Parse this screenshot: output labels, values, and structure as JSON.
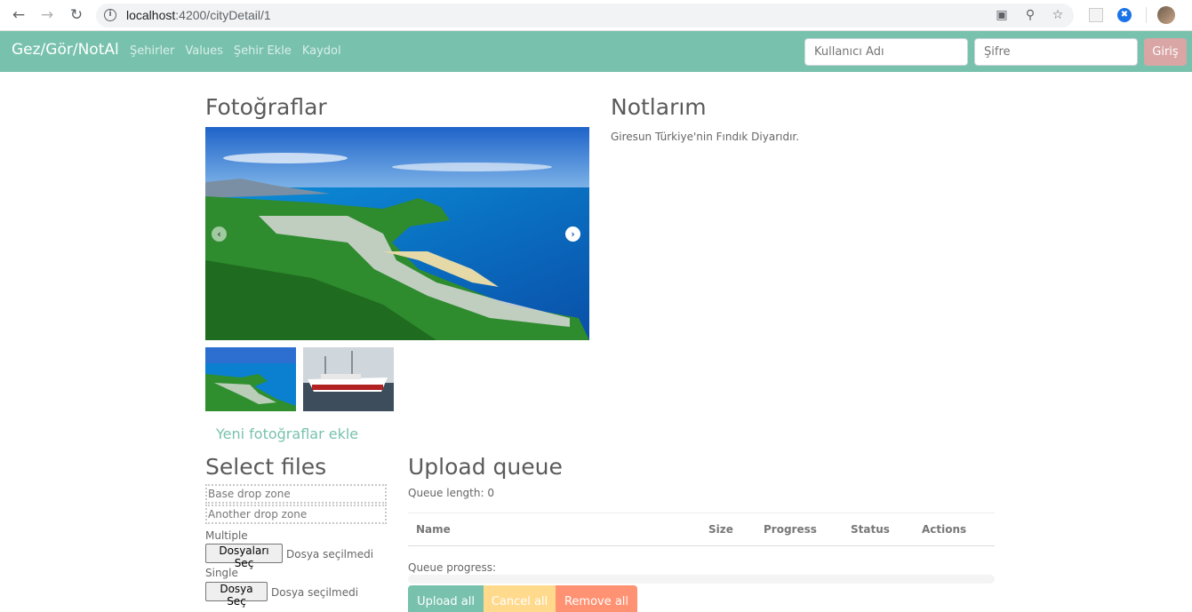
{
  "browser": {
    "url_host": "localhost",
    "url_rest": ":4200/cityDetail/1",
    "icons": [
      "back-icon",
      "forward-icon",
      "reload-icon",
      "info-icon",
      "translate-icon",
      "zoom-icon",
      "star-icon"
    ]
  },
  "navbar": {
    "brand": "Gez/Gör/NotAl",
    "links": [
      "Şehirler",
      "Values",
      "Şehir Ekle",
      "Kaydol"
    ],
    "username_placeholder": "Kullanıcı Adı",
    "password_placeholder": "Şifre",
    "login_label": "Giriş"
  },
  "photos": {
    "title": "Fotoğraflar",
    "add_link": "Yeni fotoğraflar ekle"
  },
  "notes": {
    "title": "Notlarım",
    "text": "Giresun Türkiye'nin Fındık Diyarıdır."
  },
  "upload": {
    "select_title": "Select files",
    "base_drop": "Base drop zone",
    "another_drop": "Another drop zone",
    "multiple_label": "Multiple",
    "multiple_button": "Dosyaları Seç",
    "multiple_status": "Dosya seçilmedi",
    "single_label": "Single",
    "single_button": "Dosya Seç",
    "single_status": "Dosya seçilmedi",
    "queue_title": "Upload queue",
    "queue_length": "Queue length: 0",
    "columns": [
      "Name",
      "Size",
      "Progress",
      "Status",
      "Actions"
    ],
    "queue_progress_label": "Queue progress:",
    "queue_progress": 0,
    "upload_all": "Upload all",
    "cancel_all": "Cancel all",
    "remove_all": "Remove all"
  },
  "colors": {
    "primary": "#78c2ad",
    "warning": "#ffce67",
    "danger": "#ff7851",
    "login": "#d9a5a5"
  }
}
